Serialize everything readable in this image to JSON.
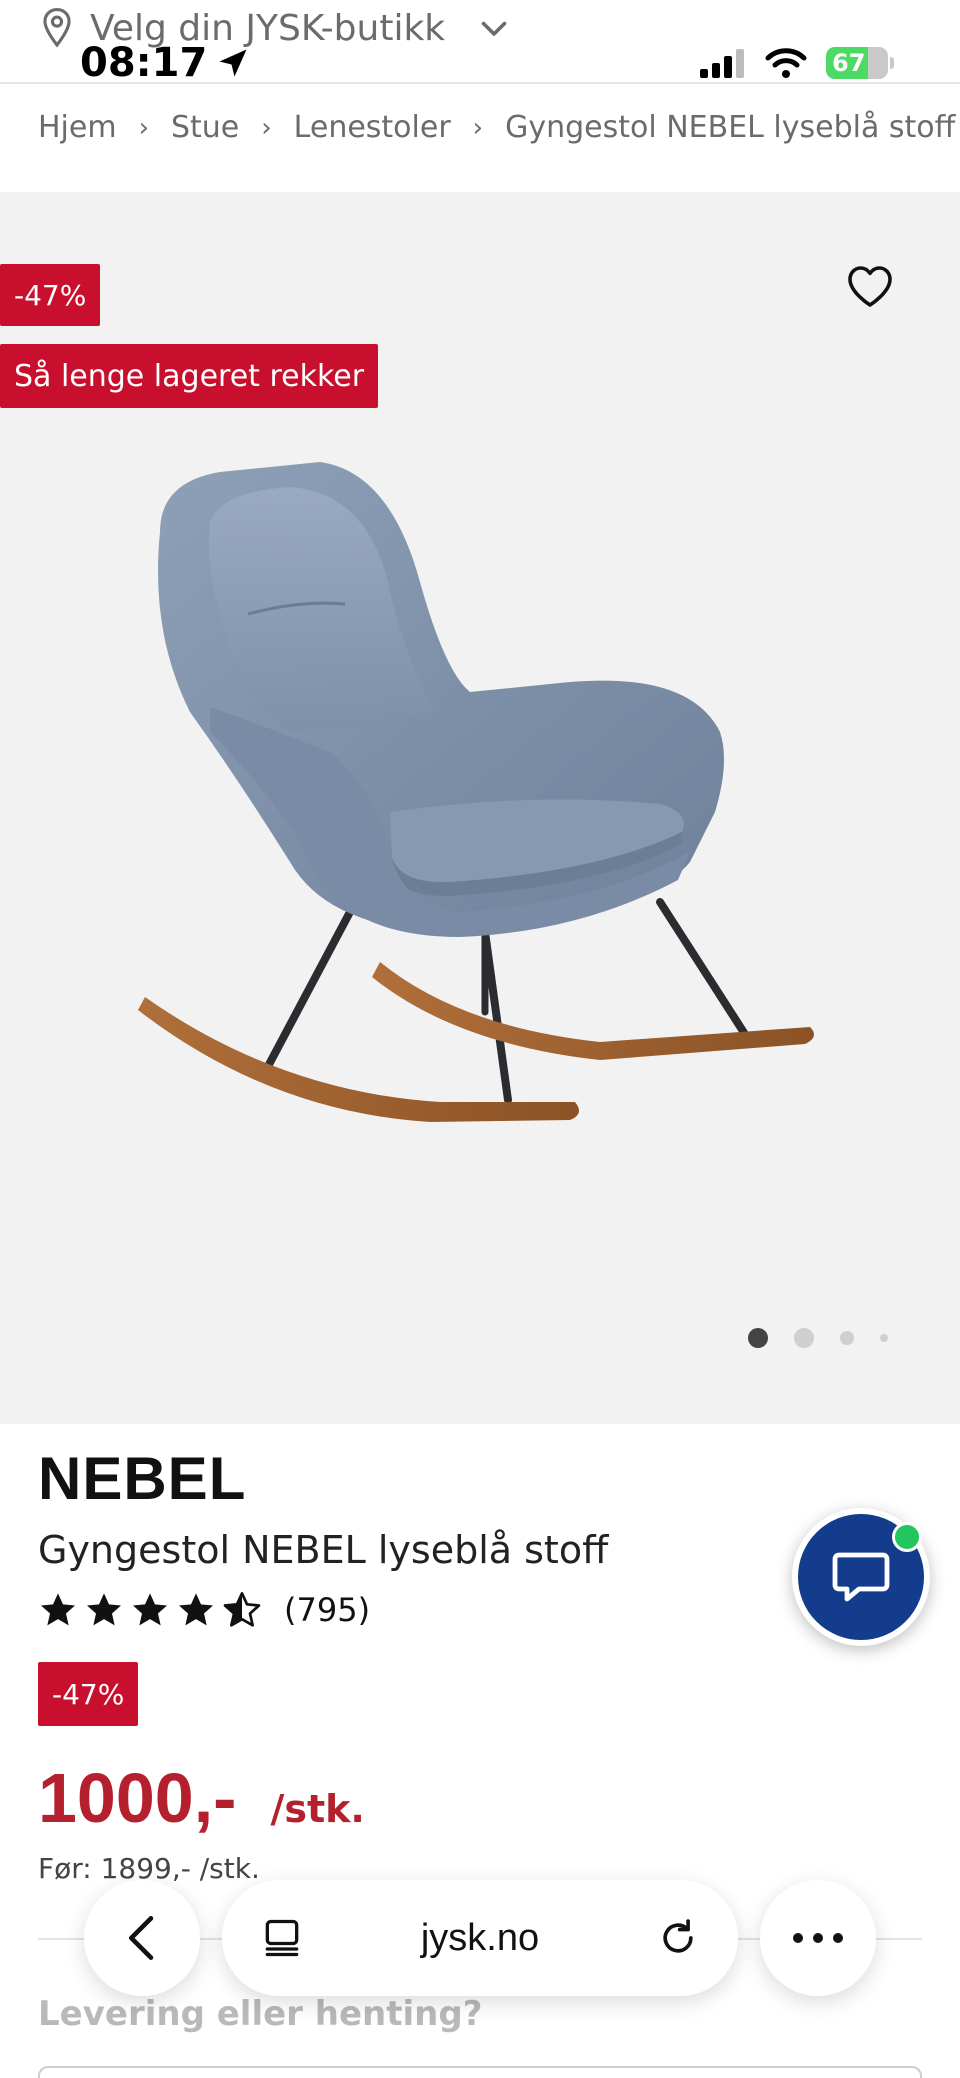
{
  "status_bar": {
    "time": "08:17",
    "battery_percent": 67,
    "battery_label": "67"
  },
  "store_selector": {
    "label": "Velg din JYSK-butikk"
  },
  "breadcrumb": [
    "Hjem",
    "Stue",
    "Lenestoler",
    "Gyngestol NEBEL lyseblå stoff"
  ],
  "gallery": {
    "discount_badge": "-47%",
    "stock_badge": "Så lenge lageret rekker",
    "image_count": 4,
    "active_index": 0
  },
  "product": {
    "brand": "NEBEL",
    "name": "Gyngestol NEBEL lyseblå stoff",
    "rating": 4.5,
    "review_count": "(795)",
    "discount_badge": "-47%",
    "price": "1000,-",
    "price_unit": "/stk.",
    "before_price": "Før: 1899,- /stk."
  },
  "delivery": {
    "heading": "Levering eller henting?"
  },
  "browser": {
    "url": "jysk.no"
  },
  "colors": {
    "sale_red": "#c8102e",
    "price_red": "#b5202e",
    "chat_blue": "#143c8c",
    "online_green": "#22c55e"
  }
}
